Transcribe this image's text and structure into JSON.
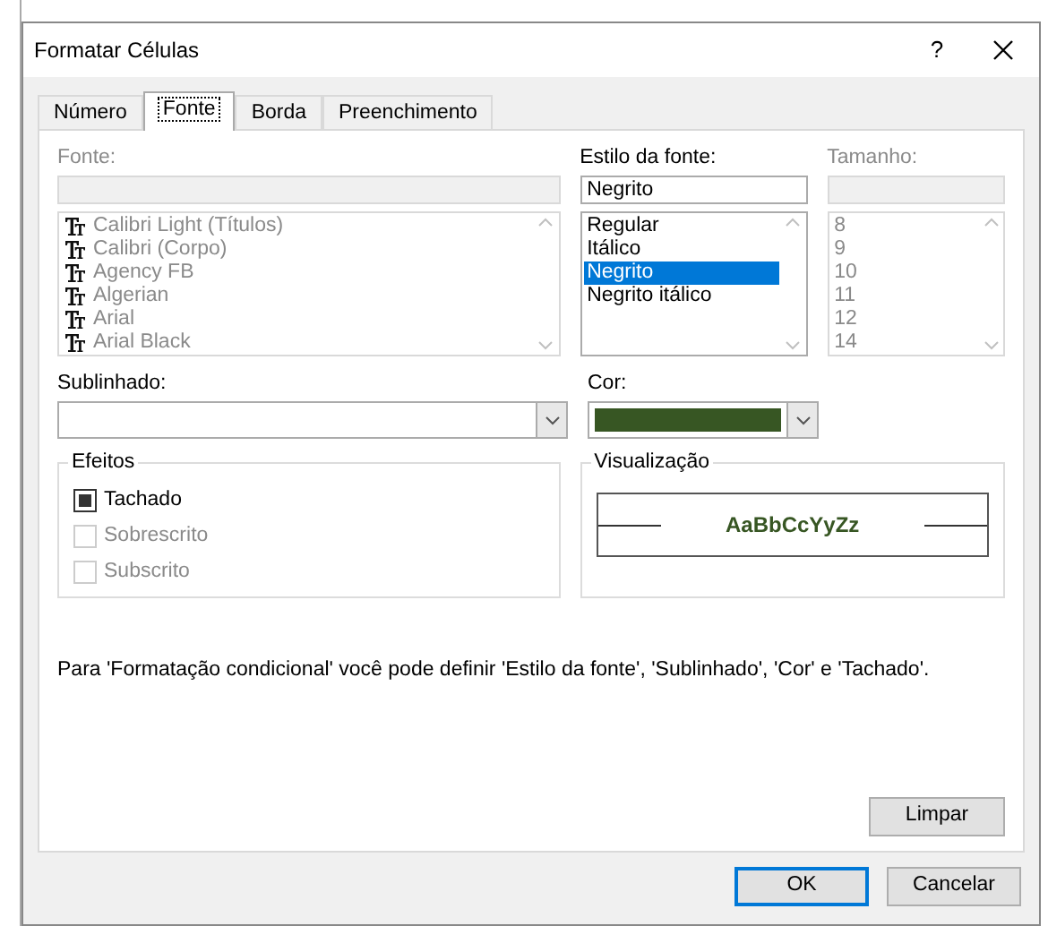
{
  "window": {
    "title": "Formatar Células",
    "help_button": "?"
  },
  "tabs": [
    {
      "label": "Número",
      "selected": false
    },
    {
      "label": "Fonte",
      "selected": true
    },
    {
      "label": "Borda",
      "selected": false
    },
    {
      "label": "Preenchimento",
      "selected": false
    }
  ],
  "font": {
    "label": "Fonte:",
    "disabled": true,
    "items": [
      "Calibri Light (Títulos)",
      "Calibri (Corpo)",
      "Agency FB",
      "Algerian",
      "Arial",
      "Arial Black"
    ]
  },
  "font_style": {
    "label": "Estilo da fonte:",
    "value": "Negrito",
    "items": [
      {
        "label": "Regular",
        "selected": false
      },
      {
        "label": "Itálico",
        "selected": false
      },
      {
        "label": "Negrito",
        "selected": true
      },
      {
        "label": "Negrito itálico",
        "selected": false
      }
    ]
  },
  "size": {
    "label": "Tamanho:",
    "disabled": true,
    "items": [
      "8",
      "9",
      "10",
      "11",
      "12",
      "14"
    ]
  },
  "underline": {
    "label": "Sublinhado:"
  },
  "color": {
    "label": "Cor:",
    "color": "#375623"
  },
  "effects": {
    "title": "Efeitos",
    "items": [
      {
        "label": "Tachado",
        "checked": true,
        "disabled": false
      },
      {
        "label": "Sobrescrito",
        "checked": false,
        "disabled": true
      },
      {
        "label": "Subscrito",
        "checked": false,
        "disabled": true
      }
    ]
  },
  "preview": {
    "title": "Visualização",
    "sample": "AaBbCcYyZz"
  },
  "note": "Para 'Formatação condicional' você pode definir 'Estilo da fonte', 'Sublinhado', 'Cor' e 'Tachado'.",
  "clear_button": {
    "label": "Limpar"
  },
  "buttons": [
    {
      "label": "OK",
      "kind": "default"
    },
    {
      "label": "Cancelar",
      "kind": "normal"
    }
  ]
}
